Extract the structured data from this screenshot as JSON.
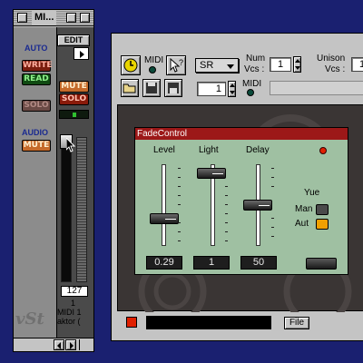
{
  "channel_window": {
    "title": "MI...",
    "edit_label": "EDIT",
    "auto_label": "AUTO",
    "write_label": "WRITE",
    "read_label": "READ",
    "mute_label": "MUTE",
    "solo_label": "SOLO",
    "audio_label": "AUDIO",
    "audio_mute_label": "MUTE",
    "fader_value": "127",
    "channel_number": "1",
    "channel_name": "MIDI 1",
    "instrument_name": "aktor (",
    "logo": "vSt"
  },
  "instrument_window": {
    "midi_label": "MIDI",
    "snapshot_value": "SR",
    "num_label": "Num",
    "vcs_label": "Vcs :",
    "num_vcs_value": "1",
    "unison_label": "Unison",
    "unison_vcs_label": "Vcs :",
    "unison_value": "1",
    "midi2_label": "MIDI",
    "voices_value": "1",
    "file_label": "File"
  },
  "fade_control": {
    "title": "FadeControl",
    "level_label": "Level",
    "light_label": "Light",
    "delay_label": "Delay",
    "level_value": "0.29",
    "light_value": "1",
    "delay_value": "50",
    "yue_label": "Yue",
    "man_label": "Man",
    "aut_label": "Aut"
  },
  "colors": {
    "desktop": "#1a2070",
    "panel_green": "#9fc0a2",
    "titlebar_red": "#9c1818",
    "led_red": "#e02000",
    "aut_orange": "#f0a000"
  }
}
